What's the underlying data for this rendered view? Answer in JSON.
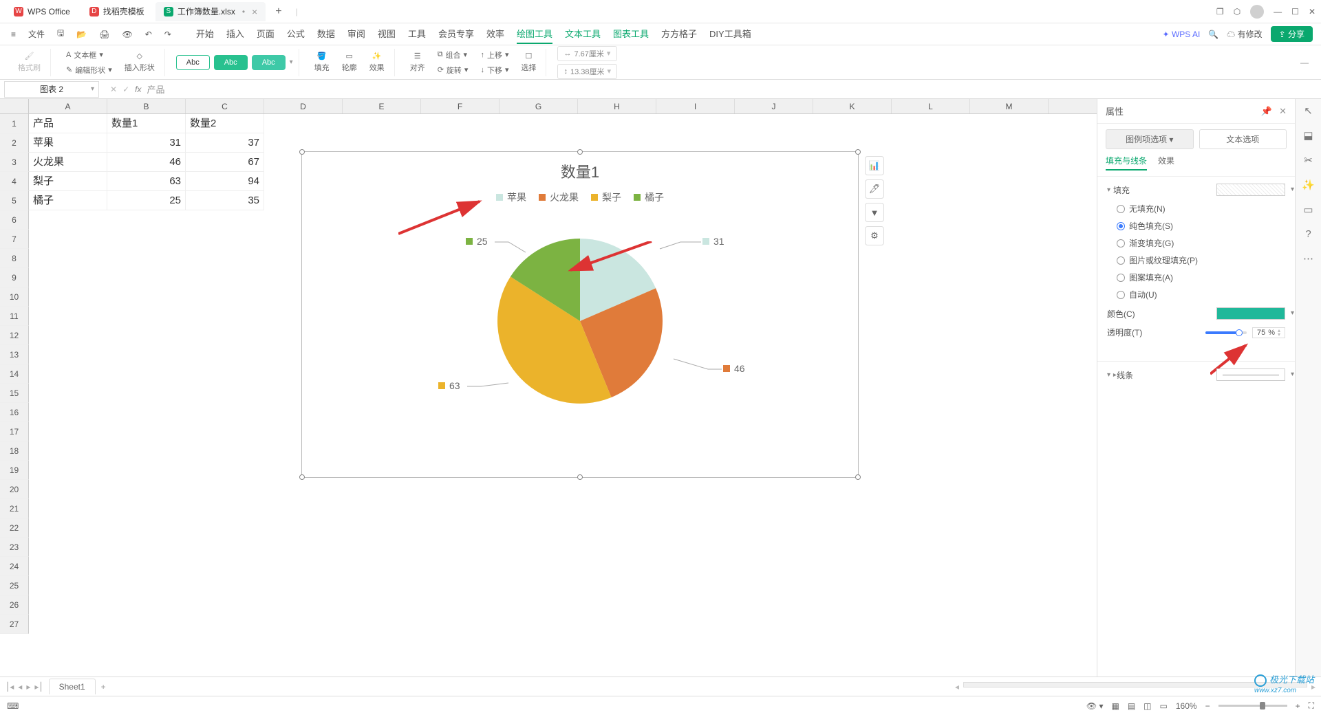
{
  "app": {
    "title": "WPS Office",
    "tab_template": "找稻壳模板",
    "tab_file": "工作簿数量.xlsx"
  },
  "menus": {
    "file": "文件",
    "tabs": [
      "开始",
      "插入",
      "页面",
      "公式",
      "数据",
      "审阅",
      "视图",
      "工具",
      "会员专享",
      "效率",
      "绘图工具",
      "文本工具",
      "图表工具",
      "方方格子",
      "DIY工具箱"
    ],
    "active_index": 10,
    "wpsai": "WPS AI",
    "edit": "有修改",
    "share": "分享"
  },
  "ribbon": {
    "format_brush": "格式刷",
    "insert_shape": "插入形状",
    "textbox": "文本框",
    "edit_shape": "编辑形状",
    "abc1": "Abc",
    "abc2": "Abc",
    "abc3": "Abc",
    "fill": "填充",
    "outline": "轮廓",
    "effect": "效果",
    "align": "对齐",
    "group": "组合",
    "rotate": "旋转",
    "up": "上移",
    "down": "下移",
    "select": "选择",
    "width": "7.67厘米",
    "height": "13.38厘米"
  },
  "namebox": "图表 2",
  "fx": "产品",
  "columns": [
    "A",
    "B",
    "C",
    "D",
    "E",
    "F",
    "G",
    "H",
    "I",
    "J",
    "K",
    "L",
    "M"
  ],
  "rows": 27,
  "data": {
    "h1": "产品",
    "h2": "数量1",
    "h3": "数量2",
    "r1c1": "苹果",
    "r1c2": "31",
    "r1c3": "37",
    "r2c1": "火龙果",
    "r2c2": "46",
    "r2c3": "67",
    "r3c1": "梨子",
    "r3c2": "63",
    "r3c3": "94",
    "r4c1": "橘子",
    "r4c2": "25",
    "r4c3": "35"
  },
  "chart": {
    "title": "数量1",
    "legend": [
      "苹果",
      "火龙果",
      "梨子",
      "橘子"
    ],
    "colors": {
      "apple": "#cae6e0",
      "dragon": "#e07b3a",
      "pear": "#ebb32b",
      "orange": "#7cb342"
    },
    "labels": {
      "apple": "31",
      "dragon": "46",
      "pear": "63",
      "orange": "25"
    }
  },
  "chart_data": {
    "type": "pie",
    "title": "数量1",
    "categories": [
      "苹果",
      "火龙果",
      "梨子",
      "橘子"
    ],
    "values": [
      31,
      46,
      63,
      25
    ],
    "series": [
      {
        "name": "数量1",
        "values": [
          31,
          46,
          63,
          25
        ]
      }
    ],
    "colors": [
      "#cae6e0",
      "#e07b3a",
      "#ebb32b",
      "#7cb342"
    ],
    "legend_position": "top",
    "data_labels": true
  },
  "panel": {
    "title": "属性",
    "tab1": "图例项选项",
    "tab2": "文本选项",
    "sub_fill": "填充与线条",
    "sub_effect": "效果",
    "section_fill": "填充",
    "radios": {
      "none": "无填充(N)",
      "solid": "纯色填充(S)",
      "grad": "渐变填充(G)",
      "pic": "图片或纹理填充(P)",
      "pattern": "图案填充(A)",
      "auto": "自动(U)"
    },
    "color": "颜色(C)",
    "trans": "透明度(T)",
    "trans_val": "75",
    "pct": "%",
    "section_line": "线条"
  },
  "sheet_tabs": {
    "name": "Sheet1"
  },
  "status": {
    "zoom": "160%"
  },
  "watermark": {
    "text": "极光下载站",
    "url": "www.xz7.com"
  }
}
